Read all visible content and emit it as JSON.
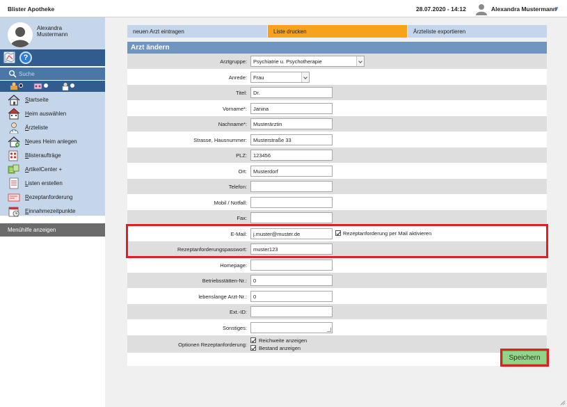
{
  "header": {
    "app_title": "Blister Apotheke",
    "datetime": "28.07.2020 - 14:12",
    "user_name": "Alexandra Mustermann"
  },
  "sidebar": {
    "profile_first": "Alexandra",
    "profile_last": "Mustermann",
    "search_placeholder": "Suche",
    "menu": [
      {
        "label": "Startseite",
        "icon": "home-icon"
      },
      {
        "label": "Heim auswählen",
        "icon": "building-icon"
      },
      {
        "label": "Ärzteliste",
        "icon": "doctor-icon"
      },
      {
        "label": "Neues Heim anlegen",
        "icon": "house-add-icon"
      },
      {
        "label": "Blisteraufträge",
        "icon": "blister-order-icon"
      },
      {
        "label": "ArtikelCenter +",
        "icon": "article-center-icon"
      },
      {
        "label": "Listen erstellen",
        "icon": "list-icon"
      },
      {
        "label": "Rezeptanforderung",
        "icon": "prescription-icon"
      },
      {
        "label": "Einnahmezeitpunkte",
        "icon": "intake-times-icon"
      }
    ],
    "help_label": "Menühilfe anzeigen"
  },
  "actions": {
    "tab_new_doctor": "neuen Arzt eintragen",
    "tab_print": "Liste drucken",
    "tab_export": "Ärzteliste exportieren"
  },
  "form": {
    "title": "Arzt ändern",
    "arztgruppe_label": "Arztgruppe:",
    "arztgruppe_value": "Psychiatrie u. Psychotherapie",
    "anrede_label": "Anrede:",
    "anrede_value": "Frau",
    "titel_label": "Titel:",
    "titel_value": "Dr.",
    "vorname_label": "Vorname*:",
    "vorname_value": "Janina",
    "nachname_label": "Nachname*:",
    "nachname_value": "Musterärztin",
    "strasse_label": "Strasse, Hausnummer:",
    "strasse_value": "Musterstraße 33",
    "plz_label": "PLZ:",
    "plz_value": "123456",
    "ort_label": "Ort:",
    "ort_value": "Musterdorf",
    "telefon_label": "Telefon:",
    "telefon_value": "",
    "mobil_label": "Mobil / Notfall:",
    "mobil_value": "",
    "fax_label": "Fax:",
    "fax_value": "",
    "email_label": "E-Mail:",
    "email_value": "j.muster@muster.de",
    "email_checkbox_label": "Rezeptanforderung per Mail aktivieren",
    "passwort_label": "Rezeptanforderungspasswort:",
    "passwort_value": "muster123",
    "homepage_label": "Homepage:",
    "homepage_value": "",
    "bsnr_label": "Betriebsstätten-Nr.:",
    "bsnr_value": "0",
    "lanr_label": "lebenslange Arzt-Nr.:",
    "lanr_value": "0",
    "extid_label": "Ext.-ID:",
    "extid_value": "",
    "sonstiges_label": "Sonstiges:",
    "sonstiges_value": "",
    "optionen_label": "Optionen Rezeptanforderung:",
    "option_reichweite": "Reichweite anzeigen",
    "option_bestand": "Bestand anzeigen",
    "save_label": "Speichern"
  },
  "colors": {
    "accent_blue": "#305d8e",
    "tab_orange": "#f7a21b",
    "save_green": "#95d28a",
    "highlight_red": "#e02020"
  }
}
